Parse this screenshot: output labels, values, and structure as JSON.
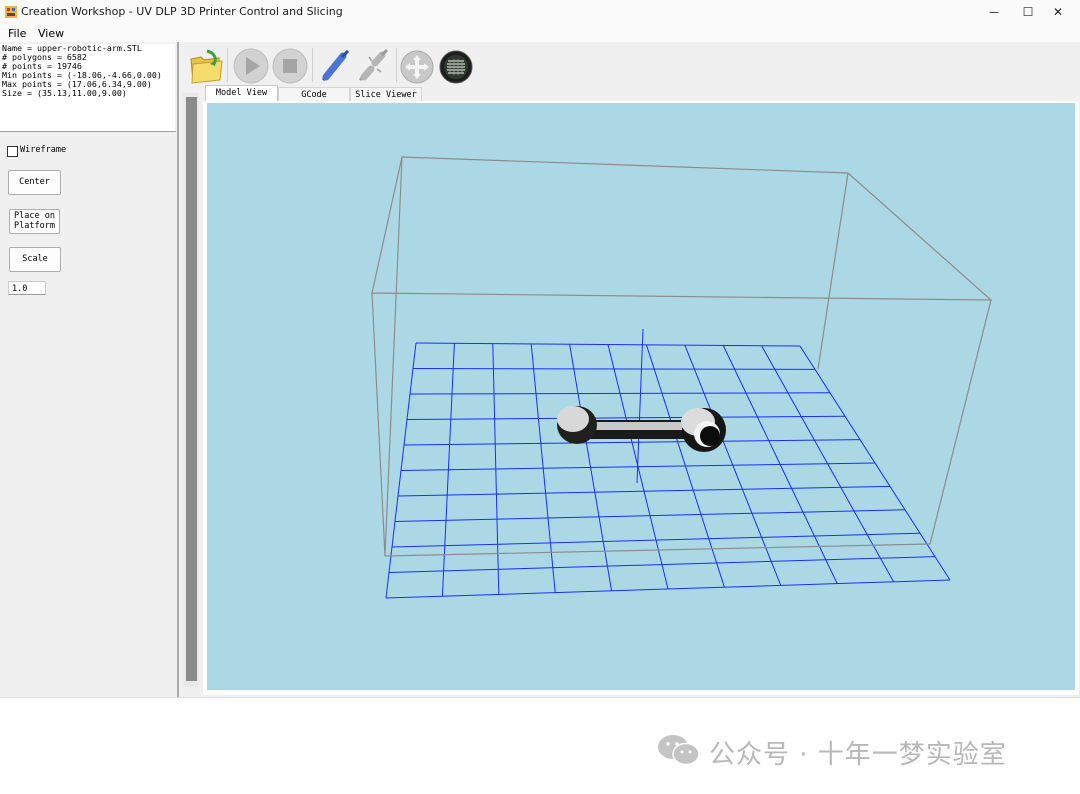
{
  "window": {
    "title": "Creation Workshop - UV DLP 3D Printer Control and Slicing",
    "minimize": "─",
    "maximize": "☐",
    "close": "✕"
  },
  "menu": {
    "file": "File",
    "view": "View"
  },
  "model_info": {
    "lines": [
      "Name = upper-robotic-arm.STL",
      "# polygons = 6582",
      "# points = 19746",
      "Min points = (-18.06,-4.66,0.00)",
      "Max points = (17.06,6.34,9.00)",
      "Size = (35.13,11.00,9.00)"
    ]
  },
  "controls": {
    "wireframe_label": "Wireframe",
    "wireframe_checked": false,
    "center_label": "Center",
    "place_line1": "Place on",
    "place_line2": "Platform",
    "scale_label": "Scale",
    "scale_value": "1.0"
  },
  "toolbar": {
    "icons": [
      "open-folder-icon",
      "play-icon",
      "stop-icon",
      "connect-icon",
      "disconnect-icon",
      "move-icon",
      "slice-icon"
    ]
  },
  "tabs": [
    "Model View",
    "GCode",
    "Slice Viewer"
  ],
  "viewport": {
    "background": "#acd8e6",
    "grid_color": "#1a2cff",
    "box_color": "#8c8c8c"
  },
  "watermark": {
    "text": "公众号 · 十年一梦实验室"
  }
}
